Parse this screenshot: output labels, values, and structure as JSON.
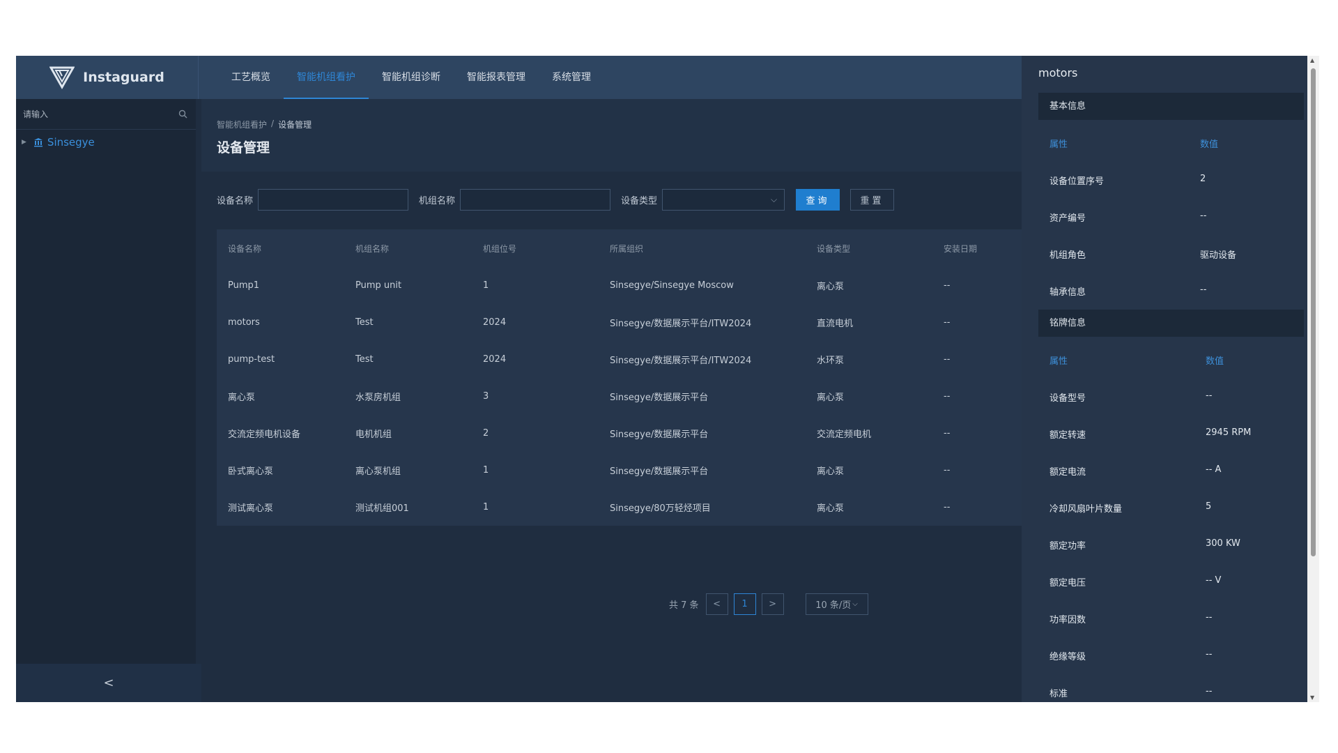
{
  "header": {
    "app_name": "Instaguard",
    "nav": [
      {
        "label": "工艺概览",
        "active": false
      },
      {
        "label": "智能机组看护",
        "active": true
      },
      {
        "label": "智能机组诊断",
        "active": false
      },
      {
        "label": "智能报表管理",
        "active": false
      },
      {
        "label": "系统管理",
        "active": false
      }
    ]
  },
  "sidebar": {
    "search_placeholder": "请输入",
    "tree_root": "Sinsegye",
    "collapse_symbol": "<"
  },
  "main": {
    "breadcrumb": [
      "智能机组看护",
      "设备管理"
    ],
    "breadcrumb_sep": "/",
    "title": "设备管理",
    "filters": {
      "device_name_label": "设备名称",
      "unit_name_label": "机组名称",
      "device_type_label": "设备类型",
      "query_label": "查询",
      "reset_label": "重置"
    },
    "table": {
      "headers": [
        "设备名称",
        "机组名称",
        "机组位号",
        "所属组织",
        "设备类型",
        "安装日期"
      ],
      "rows": [
        [
          "Pump1",
          "Pump unit",
          "1",
          "Sinsegye/Sinsegye Moscow",
          "离心泵",
          "--"
        ],
        [
          "motors",
          "Test",
          "2024",
          "Sinsegye/数据展示平台/ITW2024",
          "直流电机",
          "--"
        ],
        [
          "pump-test",
          "Test",
          "2024",
          "Sinsegye/数据展示平台/ITW2024",
          "水环泵",
          "--"
        ],
        [
          "离心泵",
          "水泵房机组",
          "3",
          "Sinsegye/数据展示平台",
          "离心泵",
          "--"
        ],
        [
          "交流定频电机设备",
          "电机机组",
          "2",
          "Sinsegye/数据展示平台",
          "交流定频电机",
          "--"
        ],
        [
          "卧式离心泵",
          "离心泵机组",
          "1",
          "Sinsegye/数据展示平台",
          "离心泵",
          "--"
        ],
        [
          "测试离心泵",
          "测试机组001",
          "1",
          "Sinsegye/80万轻烃项目",
          "离心泵",
          "--"
        ]
      ]
    },
    "pagination": {
      "total_text": "共 7 条",
      "prev": "<",
      "current": "1",
      "next": ">",
      "page_size": "10 条/页"
    }
  },
  "drawer": {
    "title": "motors",
    "basic": {
      "section_label": "基本信息",
      "col_attr": "属性",
      "col_value": "数值",
      "rows": [
        {
          "k": "设备位置序号",
          "v": "2"
        },
        {
          "k": "资产编号",
          "v": "--"
        },
        {
          "k": "机组角色",
          "v": "驱动设备"
        },
        {
          "k": "轴承信息",
          "v": "--"
        }
      ]
    },
    "nameplate": {
      "section_label": "铭牌信息",
      "col_attr": "属性",
      "col_value": "数值",
      "rows": [
        {
          "k": "设备型号",
          "v": "--"
        },
        {
          "k": "额定转速",
          "v": "2945 RPM"
        },
        {
          "k": "额定电流",
          "v": "-- A"
        },
        {
          "k": "冷却风扇叶片数量",
          "v": "5"
        },
        {
          "k": "额定功率",
          "v": "300 KW"
        },
        {
          "k": "额定电压",
          "v": "-- V"
        },
        {
          "k": "功率因数",
          "v": "--"
        },
        {
          "k": "绝缘等级",
          "v": "--"
        },
        {
          "k": "标准",
          "v": "--"
        }
      ]
    }
  },
  "colors": {
    "accent": "#2e86d6",
    "header_bg": "#2e4561",
    "page_bg": "#1f2d40",
    "drawer_bg": "#26354a"
  },
  "icons": [
    "logo-v-icon",
    "search-icon",
    "caret-right-icon",
    "building-icon",
    "chevron-left-icon",
    "chevron-down-icon"
  ]
}
